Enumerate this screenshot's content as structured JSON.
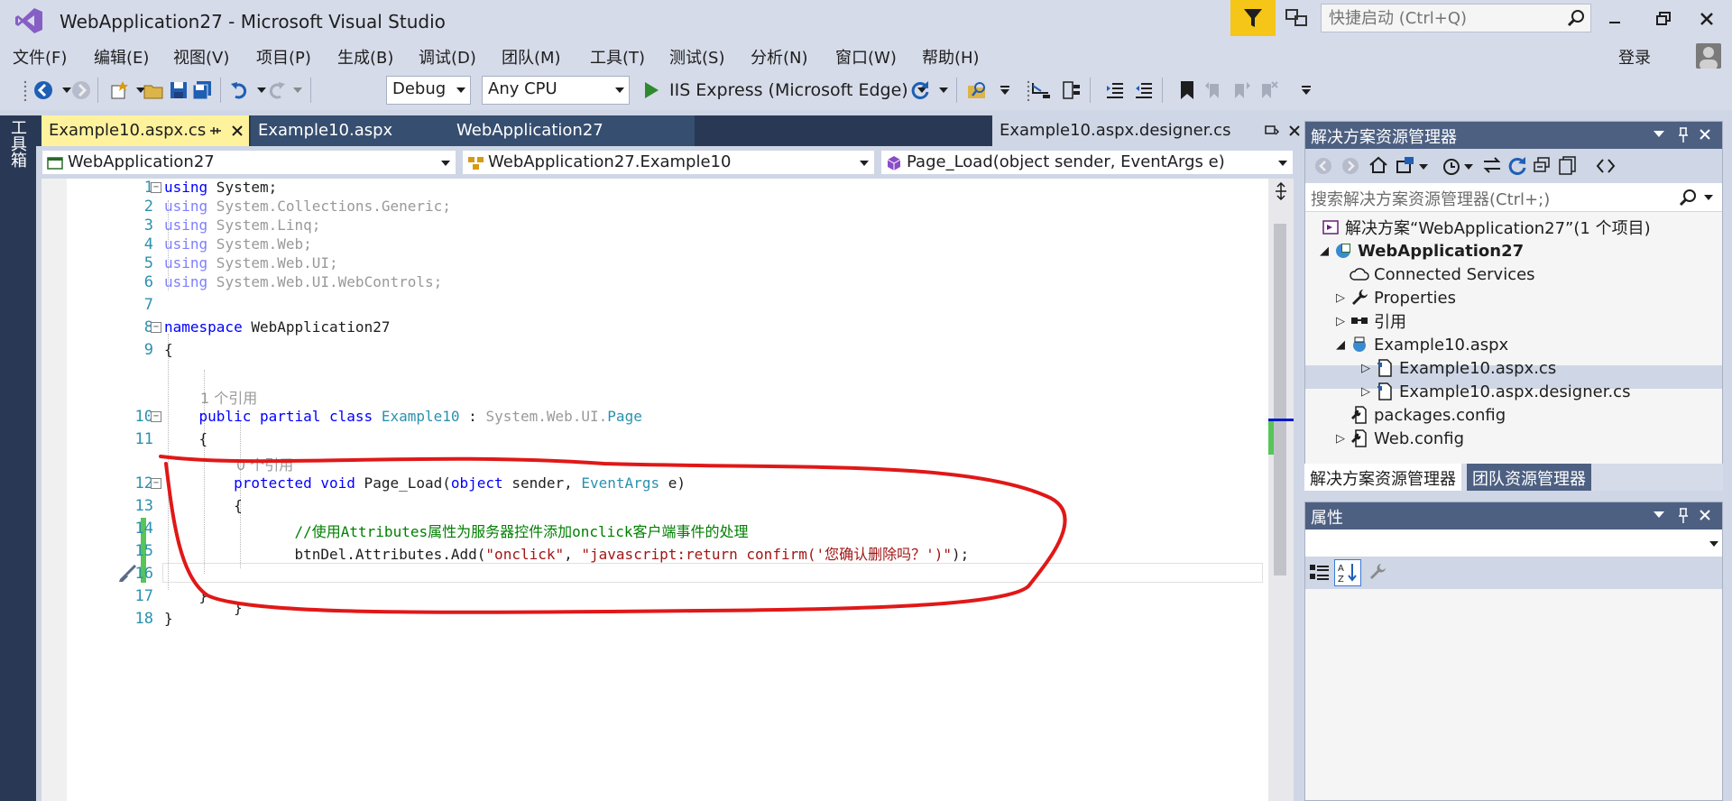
{
  "window": {
    "title": "WebApplication27 - Microsoft Visual Studio",
    "quick_launch_placeholder": "快捷启动 (Ctrl+Q)"
  },
  "menu": {
    "items": [
      "文件(F)",
      "编辑(E)",
      "视图(V)",
      "项目(P)",
      "生成(B)",
      "调试(D)",
      "团队(M)",
      "工具(T)",
      "测试(S)",
      "分析(N)",
      "窗口(W)",
      "帮助(H)"
    ],
    "sign_in": "登录"
  },
  "toolbar": {
    "config": "Debug",
    "platform": "Any CPU",
    "run_target": "IIS Express (Microsoft Edge)"
  },
  "toolbox": {
    "label": "工具箱"
  },
  "doc_tabs": {
    "active": "Example10.aspx.cs",
    "tab2": "Example10.aspx",
    "tab3": "WebApplication27",
    "designer": "Example10.aspx.designer.cs"
  },
  "nav_bar": {
    "project": "WebApplication27",
    "type": "WebApplication27.Example10",
    "member": "Page_Load(object sender, EventArgs e)"
  },
  "code": {
    "lines": [
      {
        "n": "1",
        "segs": [
          [
            "kw",
            "using"
          ],
          [
            "",
            " System;"
          ]
        ]
      },
      {
        "n": "2",
        "segs": [
          [
            "kw-dim",
            "using"
          ],
          [
            "dim",
            " System.Collections.Generic;"
          ]
        ]
      },
      {
        "n": "3",
        "segs": [
          [
            "kw-dim",
            "using"
          ],
          [
            "dim",
            " System.Linq;"
          ]
        ]
      },
      {
        "n": "4",
        "segs": [
          [
            "kw-dim",
            "using"
          ],
          [
            "dim",
            " System.Web;"
          ]
        ]
      },
      {
        "n": "5",
        "segs": [
          [
            "kw-dim",
            "using"
          ],
          [
            "dim",
            " System.Web.UI;"
          ]
        ]
      },
      {
        "n": "6",
        "segs": [
          [
            "kw-dim",
            "using"
          ],
          [
            "dim",
            " System.Web.UI.WebControls;"
          ]
        ]
      },
      {
        "n": "7",
        "segs": []
      },
      {
        "n": "8",
        "segs": [
          [
            "kw",
            "namespace"
          ],
          [
            "",
            " WebApplication27"
          ]
        ]
      },
      {
        "n": "9",
        "segs": [
          [
            "",
            "{"
          ]
        ]
      },
      {
        "n": "10",
        "segs": [
          [
            "",
            "    "
          ],
          [
            "kw",
            "public partial class"
          ],
          [
            "",
            " "
          ],
          [
            "typ",
            "Example10"
          ],
          [
            "",
            " : "
          ],
          [
            "dim",
            "System.Web.UI."
          ],
          [
            "typ",
            "Page"
          ]
        ]
      },
      {
        "n": "11",
        "segs": [
          [
            "",
            "    {"
          ]
        ]
      },
      {
        "n": "12",
        "segs": [
          [
            "",
            "        "
          ],
          [
            "kw",
            "protected void"
          ],
          [
            "",
            " Page_Load("
          ],
          [
            "kw",
            "object"
          ],
          [
            "",
            " sender, "
          ],
          [
            "typ",
            "EventArgs"
          ],
          [
            "",
            " e)"
          ]
        ]
      },
      {
        "n": "13",
        "segs": [
          [
            "",
            "        {"
          ]
        ]
      },
      {
        "n": "14",
        "segs": [
          [
            "",
            "               "
          ],
          [
            "cmt",
            "//使用Attributes属性为服务器控件添加onclick客户端事件的处理"
          ]
        ]
      },
      {
        "n": "15",
        "segs": [
          [
            "",
            "               btnDel.Attributes.Add("
          ],
          [
            "str",
            "\"onclick\""
          ],
          [
            "",
            ", "
          ],
          [
            "str",
            "\"javascript:return confirm('您确认删除吗？')\""
          ],
          [
            "",
            ");"
          ]
        ]
      },
      {
        "n": "16",
        "segs": [
          [
            "",
            "        }"
          ]
        ]
      },
      {
        "n": "17",
        "segs": [
          [
            "",
            "    }"
          ]
        ]
      },
      {
        "n": "18",
        "segs": [
          [
            "",
            "}"
          ]
        ]
      }
    ],
    "codelens_class": "1 个引用",
    "codelens_method": "0 个引用"
  },
  "solution_explorer": {
    "title": "解决方案资源管理器",
    "search_placeholder": "搜索解决方案资源管理器(Ctrl+;)",
    "items": {
      "solution": "解决方案“WebApplication27”(1 个项目)",
      "project": "WebApplication27",
      "connected": "Connected Services",
      "properties": "Properties",
      "refs": "引用",
      "aspx": "Example10.aspx",
      "aspx_cs": "Example10.aspx.cs",
      "aspx_designer": "Example10.aspx.designer.cs",
      "packages": "packages.config",
      "webconfig": "Web.config"
    },
    "tabs": [
      "解决方案资源管理器",
      "团队资源管理器"
    ]
  },
  "properties": {
    "title": "属性"
  },
  "colors": {
    "chrome": "#d6dbe9",
    "dark_blue": "#293955",
    "active_tab": "#fff29d",
    "panel_header": "#4d6082",
    "annotation_red": "#e01818"
  }
}
